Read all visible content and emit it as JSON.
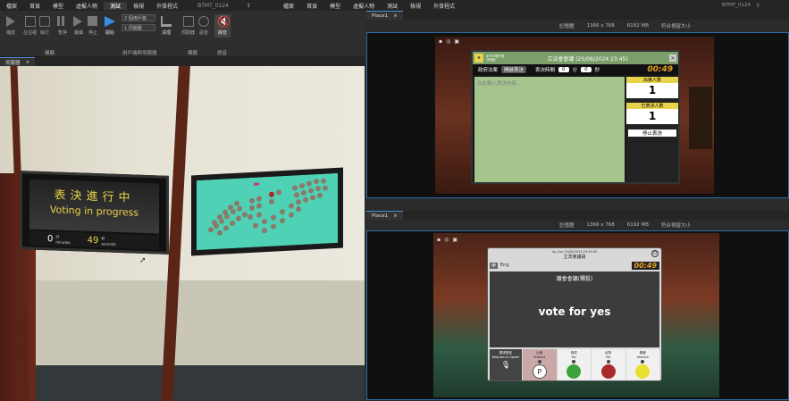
{
  "menu": {
    "items": [
      "檔案",
      "首頁",
      "模型",
      "虛擬人物",
      "測試",
      "檢視",
      "外掛程式"
    ],
    "active_index": 4,
    "title": "BTMT_0124",
    "right_items": [
      "首頁",
      "模型",
      "虛擬人物",
      "測試",
      "檢視",
      "外掛程式"
    ],
    "right_title": "BTMT_0124"
  },
  "ribbon": {
    "play": "播放",
    "here": "在這裡",
    "run": "執行",
    "pause": "暫停",
    "stop": "停止",
    "resume": "繼續",
    "clients": "用戶端",
    "start": "開始",
    "team": "2 個用戶端",
    "player_select": "1 伺服器",
    "clean": "清理",
    "server": "伺服器",
    "voice": "語音",
    "mute": "靜音",
    "group_test": "模擬",
    "group_clients": "用戶端與伺服器",
    "group_emulation": "模擬",
    "group_audio": "語音"
  },
  "tabs": {
    "left": "伺服器",
    "right_top": "Place1",
    "right_bottom": "Place1"
  },
  "stats": {
    "mem": "記憶體",
    "resolution": "1366 x 768",
    "memory_mb": "6192 MB",
    "scale": "符合視窗大小"
  },
  "board": {
    "title_zh": "表決進行中",
    "title_en": "Voting in progress",
    "minutes": "0",
    "minutes_label": "分",
    "minutes_label_en": "minutes",
    "seconds": "49",
    "seconds_label": "秒",
    "seconds_label_en": "seconds"
  },
  "council": {
    "title": "立法會會議 (25/06/2024 23:45)",
    "logo_text": "BTMT電子表決系統",
    "tab_gov": "政府法案",
    "tab_open": "開啟表決",
    "vote_time_label": "表決時間",
    "min": "0",
    "min_unit": "分",
    "sec": "0",
    "sec_unit": "秒",
    "timer": "00:49",
    "placeholder": "在此輸入表決內容...",
    "present_label": "出席人數",
    "present": "1",
    "voted_label": "已表決人數",
    "voted": "1",
    "stop_btn": "停止表決"
  },
  "tablet": {
    "header_small": "立法會議員",
    "sub": "Vo_Sun 25/06/2024 23:45:30",
    "member_chip": "甲",
    "member_name": "Eng",
    "timer": "00:49",
    "motion_title": "議會會議(獨投)",
    "motion_text": "vote for yes",
    "request_zh": "要求發言",
    "request_en": "Request to Speak",
    "present_zh": "出席",
    "present_en": "Present",
    "yes_zh": "贊成",
    "yes_en": "Yes",
    "no_zh": "反對",
    "no_en": "No",
    "abstain_zh": "棄權",
    "abstain_en": "Abstain"
  },
  "colors": {
    "accent": "#2d6ea8",
    "yes": "#3ca23c",
    "no": "#a82a2a",
    "abstain": "#e8e030"
  }
}
